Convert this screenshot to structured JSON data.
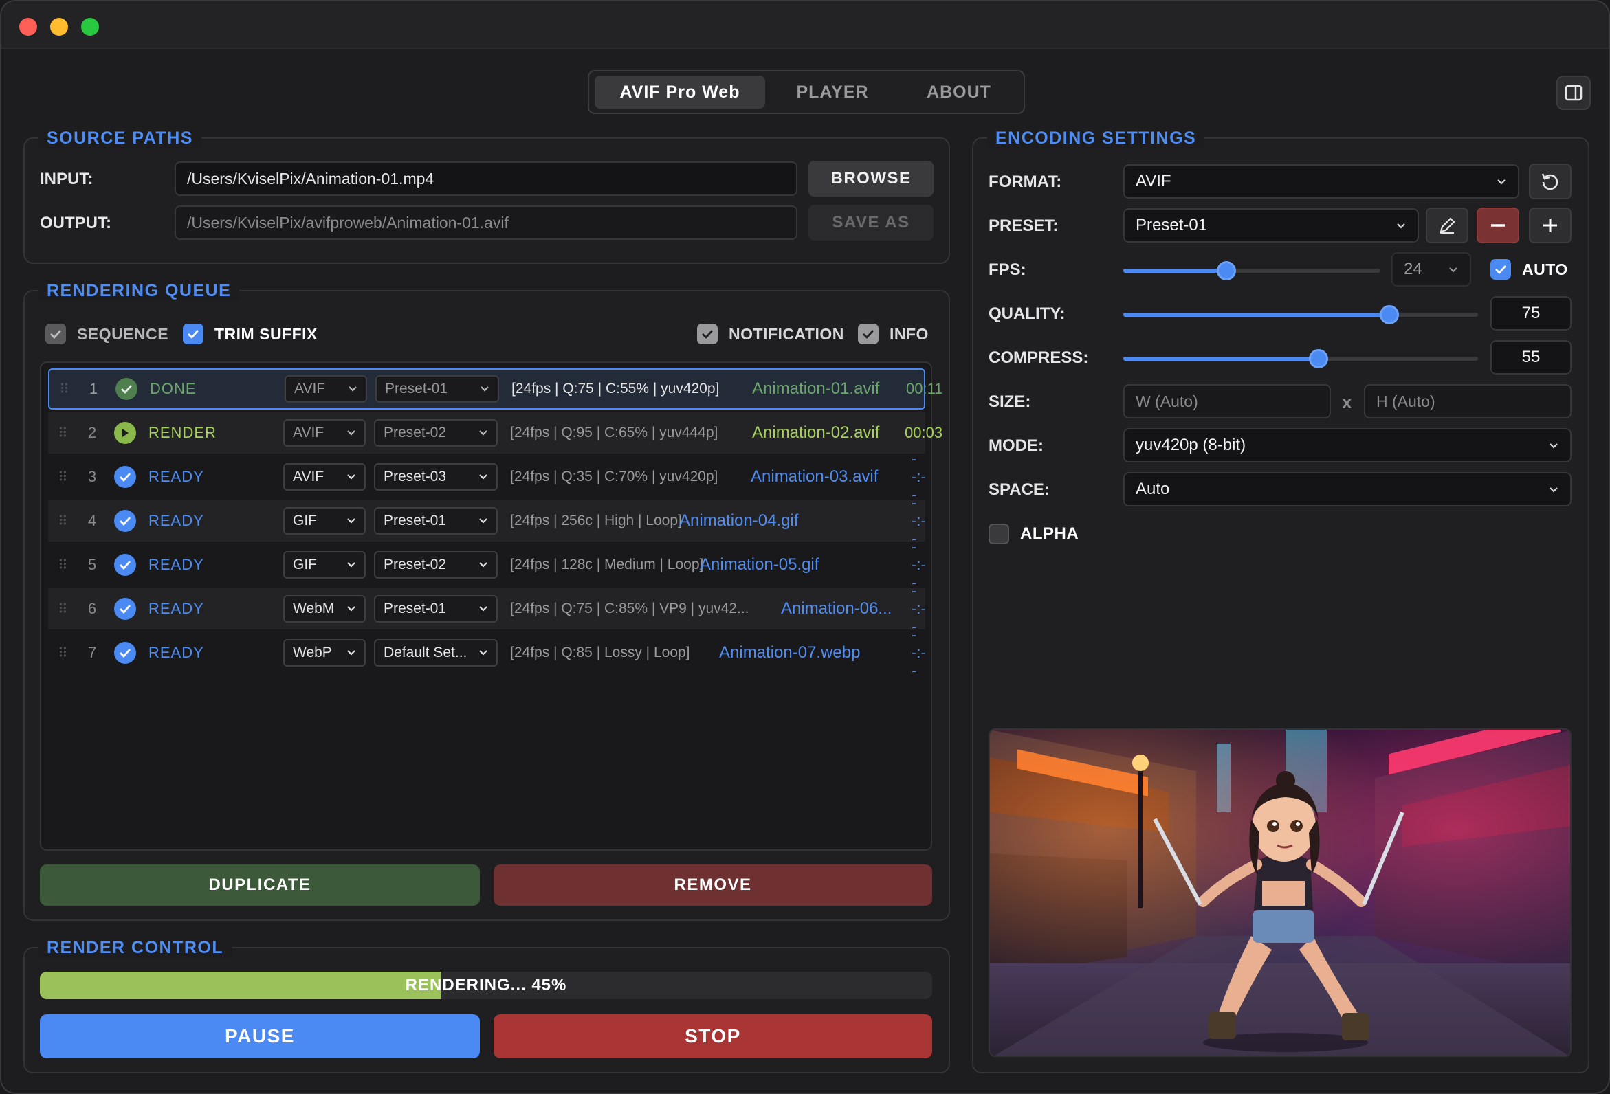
{
  "tabs": [
    {
      "label": "AVIF Pro Web",
      "active": true
    },
    {
      "label": "PLAYER",
      "active": false
    },
    {
      "label": "ABOUT",
      "active": false
    }
  ],
  "source": {
    "title": "SOURCE PATHS",
    "input_label": "INPUT:",
    "input_value": "/Users/KviselPix/Animation-01.mp4",
    "output_label": "OUTPUT:",
    "output_value": "/Users/KviselPix/avifproweb/Animation-01.avif",
    "browse_label": "BROWSE",
    "saveas_label": "SAVE AS"
  },
  "queue": {
    "title": "RENDERING QUEUE",
    "options": {
      "sequence": {
        "label": "SEQUENCE",
        "checked": true
      },
      "trim_suffix": {
        "label": "TRIM SUFFIX",
        "checked": true
      },
      "notification": {
        "label": "NOTIFICATION",
        "checked": true
      },
      "info": {
        "label": "INFO",
        "checked": true
      }
    },
    "rows": [
      {
        "num": "1",
        "status": "DONE",
        "format": "AVIF",
        "preset": "Preset-01",
        "params": "[24fps | Q:75 | C:55% | yuv420p]",
        "output": "Animation-01.avif",
        "time": "00:11"
      },
      {
        "num": "2",
        "status": "RENDER",
        "format": "AVIF",
        "preset": "Preset-02",
        "params": "[24fps | Q:95 | C:65% | yuv444p]",
        "output": "Animation-02.avif",
        "time": "00:03"
      },
      {
        "num": "3",
        "status": "READY",
        "format": "AVIF",
        "preset": "Preset-03",
        "params": "[24fps | Q:35 | C:70% | yuv420p]",
        "output": "Animation-03.avif",
        "time": "--:--"
      },
      {
        "num": "4",
        "status": "READY",
        "format": "GIF",
        "preset": "Preset-01",
        "params": "[24fps | 256c | High | Loop]",
        "output": "Animation-04.gif",
        "time": "--:--"
      },
      {
        "num": "5",
        "status": "READY",
        "format": "GIF",
        "preset": "Preset-02",
        "params": "[24fps | 128c | Medium | Loop]",
        "output": "Animation-05.gif",
        "time": "--:--"
      },
      {
        "num": "6",
        "status": "READY",
        "format": "WebM",
        "preset": "Preset-01",
        "params": "[24fps | Q:75 | C:85% | VP9 | yuv42...",
        "output": "Animation-06...",
        "time": "--:--"
      },
      {
        "num": "7",
        "status": "READY",
        "format": "WebP",
        "preset": "Default Set...",
        "params": "[24fps | Q:85 | Lossy | Loop]",
        "output": "Animation-07.webp",
        "time": "--:--"
      }
    ],
    "duplicate_label": "DUPLICATE",
    "remove_label": "REMOVE"
  },
  "render": {
    "title": "RENDER CONTROL",
    "progress_percent": 45,
    "progress_text": "RENDERING... 45%",
    "pause_label": "PAUSE",
    "stop_label": "STOP"
  },
  "encoding": {
    "title": "ENCODING SETTINGS",
    "format_label": "FORMAT:",
    "format_value": "AVIF",
    "preset_label": "PRESET:",
    "preset_value": "Preset-01",
    "fps_label": "FPS:",
    "fps_value": "24",
    "fps_slider_fraction": 0.4,
    "auto_label": "AUTO",
    "auto_checked": true,
    "quality_label": "QUALITY:",
    "quality_value": "75",
    "compress_label": "COMPRESS:",
    "compress_value": "55",
    "size_label": "SIZE:",
    "width_placeholder": "W (Auto)",
    "height_placeholder": "H (Auto)",
    "size_sep": "x",
    "mode_label": "MODE:",
    "mode_value": "yuv420p (8-bit)",
    "space_label": "SPACE:",
    "space_value": "Auto",
    "alpha_label": "ALPHA",
    "alpha_checked": false
  },
  "colors": {
    "accent": "#4a8af2",
    "done": "#6aa56a",
    "render": "#a5d15a",
    "duplicate": "#3c5a3a",
    "remove": "#6e3030",
    "stop": "#a83434"
  }
}
